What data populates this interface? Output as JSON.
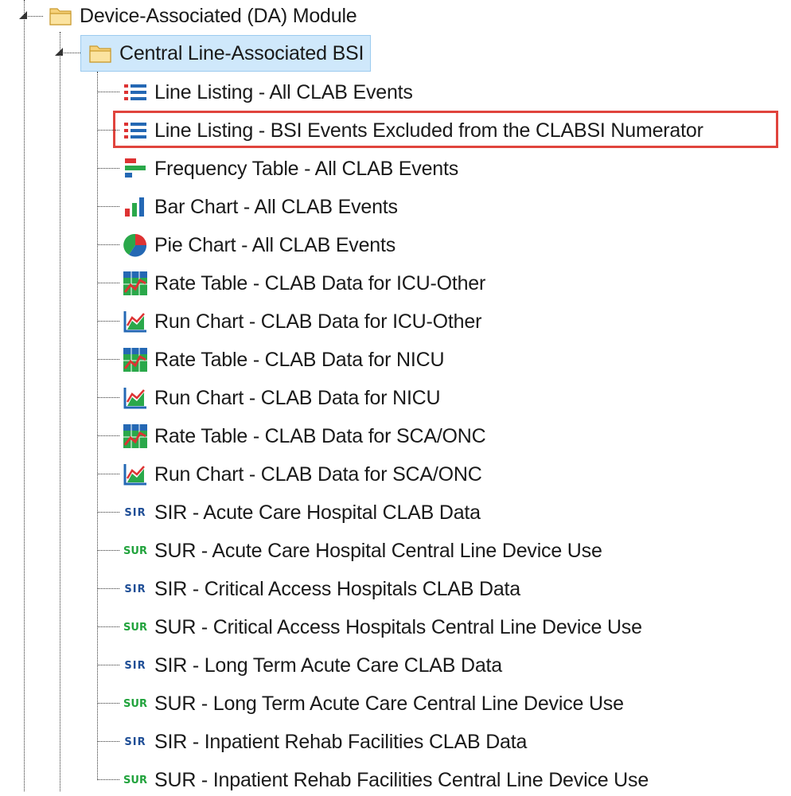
{
  "tree": {
    "module": {
      "label": "Device-Associated (DA) Module",
      "icon": "folder-icon"
    },
    "category": {
      "label": "Central Line-Associated BSI",
      "icon": "folder-open-icon"
    },
    "items": [
      {
        "label": "Line Listing - All CLAB Events",
        "icon": "line-listing-icon"
      },
      {
        "label": "Line Listing - BSI Events Excluded from the CLABSI Numerator",
        "icon": "line-listing-icon"
      },
      {
        "label": "Frequency Table - All CLAB Events",
        "icon": "frequency-table-icon"
      },
      {
        "label": "Bar Chart - All CLAB Events",
        "icon": "bar-chart-icon"
      },
      {
        "label": "Pie Chart - All CLAB Events",
        "icon": "pie-chart-icon"
      },
      {
        "label": "Rate Table - CLAB Data for ICU-Other",
        "icon": "rate-table-icon"
      },
      {
        "label": "Run Chart - CLAB Data for ICU-Other",
        "icon": "run-chart-icon"
      },
      {
        "label": "Rate Table - CLAB Data for NICU",
        "icon": "rate-table-icon"
      },
      {
        "label": "Run Chart - CLAB Data for NICU",
        "icon": "run-chart-icon"
      },
      {
        "label": "Rate Table - CLAB Data for SCA/ONC",
        "icon": "rate-table-icon"
      },
      {
        "label": "Run Chart - CLAB Data for SCA/ONC",
        "icon": "run-chart-icon"
      },
      {
        "label": "SIR - Acute Care Hospital CLAB Data",
        "icon": "sir-icon",
        "tag": "SIR"
      },
      {
        "label": "SUR - Acute Care Hospital Central Line Device Use",
        "icon": "sur-icon",
        "tag": "SUR"
      },
      {
        "label": "SIR - Critical Access Hospitals CLAB Data",
        "icon": "sir-icon",
        "tag": "SIR"
      },
      {
        "label": "SUR - Critical Access Hospitals Central Line Device Use",
        "icon": "sur-icon",
        "tag": "SUR"
      },
      {
        "label": "SIR - Long Term Acute Care CLAB Data",
        "icon": "sir-icon",
        "tag": "SIR"
      },
      {
        "label": "SUR - Long Term Acute Care Central Line Device Use",
        "icon": "sur-icon",
        "tag": "SUR"
      },
      {
        "label": "SIR - Inpatient Rehab Facilities CLAB Data",
        "icon": "sir-icon",
        "tag": "SIR"
      },
      {
        "label": "SUR - Inpatient Rehab Facilities Central Line Device Use",
        "icon": "sur-icon",
        "tag": "SUR"
      }
    ]
  },
  "colors": {
    "highlight_border": "#e0443d",
    "selection_bg": "#cfe8fb",
    "sir_blue": "#1f4e96",
    "sur_green": "#22a33d"
  }
}
